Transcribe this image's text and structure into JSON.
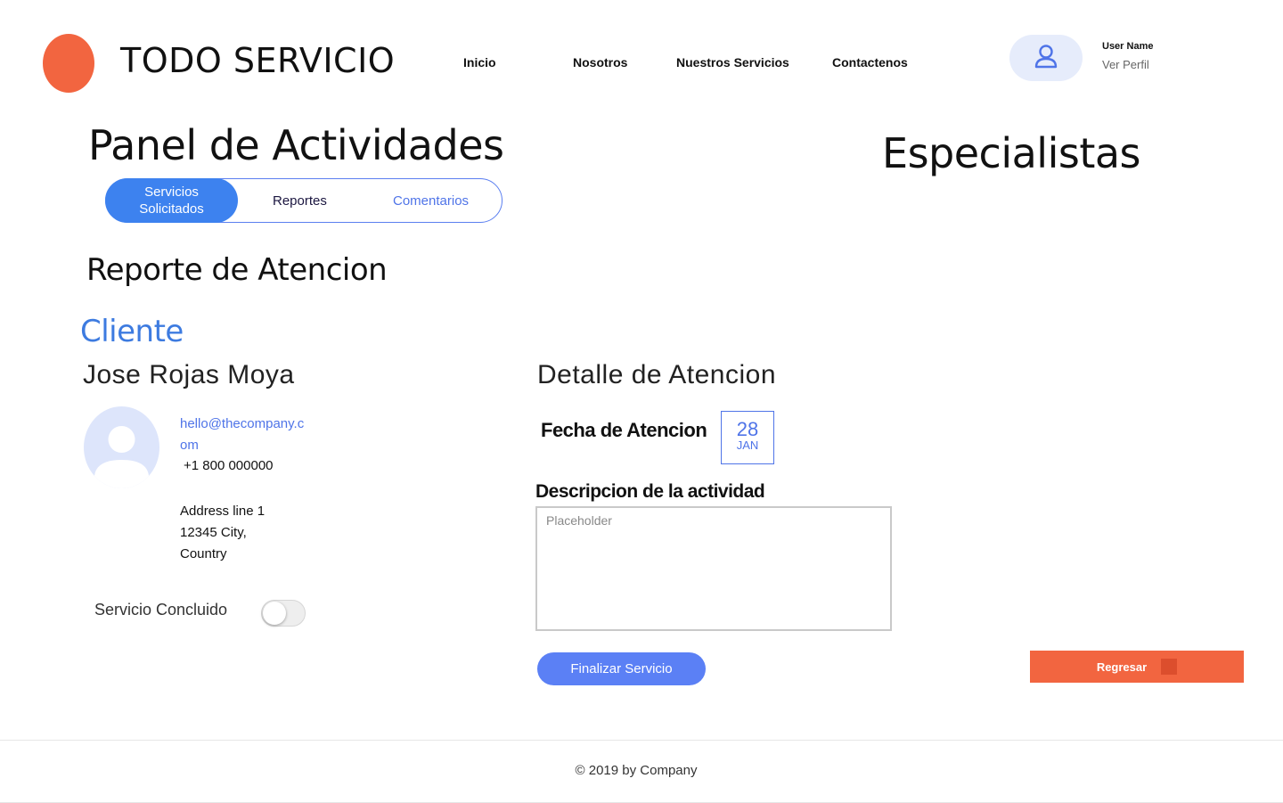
{
  "header": {
    "brand": "TODO SERVICIO",
    "nav": [
      "Inicio",
      "Nosotros",
      "Nuestros Servicios",
      "Contactenos"
    ],
    "user_name": "User Name",
    "profile_link": "Ver Perfil"
  },
  "panel": {
    "title": "Panel de Actividades",
    "tabs": [
      "Servicios Solicitados",
      "Reportes",
      "Comentarios"
    ],
    "active_tab": "Servicios Solicitados"
  },
  "side_title": "Especialistas",
  "report": {
    "title": "Reporte de Atencion",
    "client_heading": "Cliente",
    "client_name": "Jose Rojas Moya",
    "email": "hello@thecompany.com",
    "phone": "+1 800 000000",
    "address_line1": "Address line 1",
    "address_line2": "12345 City,",
    "address_line3": "Country",
    "service_done_label": "Servicio Concluido",
    "service_done": false
  },
  "detail": {
    "title": "Detalle de Atencion",
    "date_label": "Fecha de Atencion",
    "date_day": "28",
    "date_month": "JAN",
    "description_label": "Descripcion de la actividad",
    "description_value": "",
    "description_placeholder": "Placeholder"
  },
  "actions": {
    "finish": "Finalizar Servicio",
    "back": "Regresar"
  },
  "footer": {
    "copyright": "© 2019 by Company"
  },
  "colors": {
    "brand_orange": "#f26540",
    "primary_blue": "#3d82ef",
    "link_blue": "#4f74e8",
    "avatar_bg": "#dde5fb"
  },
  "icons": [
    "user-icon",
    "client-avatar-icon"
  ]
}
